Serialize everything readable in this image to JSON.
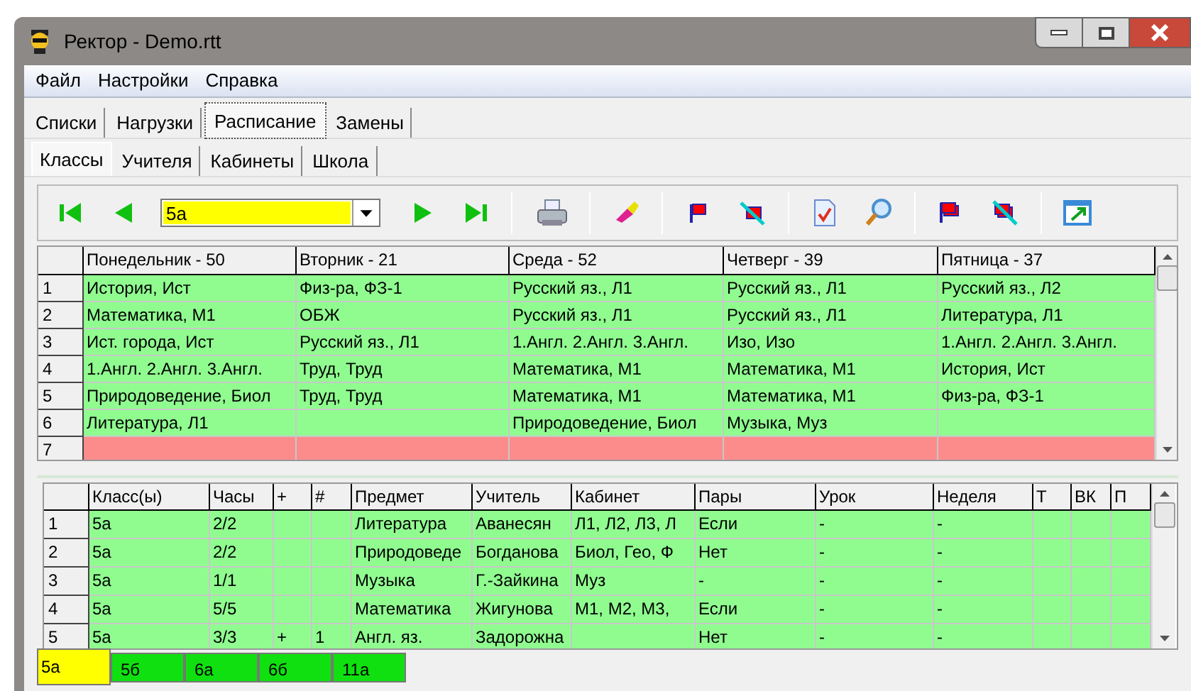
{
  "window": {
    "title": "Ректор - Demo.rtt"
  },
  "menu": [
    "Файл",
    "Настройки",
    "Справка"
  ],
  "tabs": [
    {
      "label": "Списки",
      "selected": false
    },
    {
      "label": "Нагрузки",
      "selected": false
    },
    {
      "label": "Расписание",
      "selected": true
    },
    {
      "label": "Замены",
      "selected": false
    }
  ],
  "subtabs": [
    {
      "label": "Классы",
      "selected": true
    },
    {
      "label": "Учителя",
      "selected": false
    },
    {
      "label": "Кабинеты",
      "selected": false
    },
    {
      "label": "Школа",
      "selected": false
    }
  ],
  "class_field": {
    "value": "5а"
  },
  "schedule": {
    "columns": [
      "Понедельник - 50",
      "Вторник - 21",
      "Среда - 52",
      "Четверг - 39",
      "Пятница - 37"
    ],
    "rows": [
      {
        "number": "1",
        "color": "#90fc90",
        "cells": [
          "История, Ист",
          "Физ-ра, ФЗ-1",
          "Русский яз., Л1",
          "Русский яз., Л1",
          "Русский яз., Л2"
        ]
      },
      {
        "number": "2",
        "color": "#90fc90",
        "cells": [
          "Математика, М1",
          "ОБЖ",
          "Русский яз., Л1",
          "Русский яз., Л1",
          "Литература, Л1"
        ]
      },
      {
        "number": "3",
        "color": "#90fc90",
        "cells": [
          "Ист. города, Ист",
          "Русский яз., Л1",
          "1.Англ.  2.Англ.  3.Англ.",
          "Изо, Изо",
          "1.Англ.  2.Англ.  3.Англ."
        ]
      },
      {
        "number": "4",
        "color": "#90fc90",
        "cells": [
          "1.Англ.  2.Англ.  3.Англ.",
          "Труд, Труд",
          "Математика, М1",
          "Математика, М1",
          "История, Ист"
        ]
      },
      {
        "number": "5",
        "color": "#90fc90",
        "cells": [
          "Природоведение, Биол",
          "Труд, Труд",
          "Математика, М1",
          "Математика, М1",
          "Физ-ра, ФЗ-1"
        ]
      },
      {
        "number": "6",
        "color": "#90fc90",
        "cells": [
          "Литература, Л1",
          "",
          "Природоведение, Биол",
          "Музыка, Муз",
          ""
        ]
      },
      {
        "number": "7",
        "color": "#fc8c8c",
        "cells": [
          "",
          "",
          "",
          "",
          ""
        ]
      }
    ]
  },
  "lessons": {
    "columns": [
      "Класс(ы)",
      "Часы",
      "+",
      "#",
      "Предмет",
      "Учитель",
      "Кабинет",
      "Пары",
      "Урок",
      "Неделя",
      "Т",
      "ВК",
      "П"
    ],
    "rows": [
      {
        "number": "1",
        "cells": [
          "5а",
          "2/2",
          "",
          "",
          "Литература",
          "Аванесян",
          "Л1, Л2, Л3, Л",
          "Если",
          "-",
          "-",
          "",
          "",
          ""
        ]
      },
      {
        "number": "2",
        "cells": [
          "5а",
          "2/2",
          "",
          "",
          "Природоведе",
          "Богданова",
          "Биол, Гео, Ф",
          "Нет",
          "-",
          "-",
          "",
          "",
          ""
        ]
      },
      {
        "number": "3",
        "cells": [
          "5а",
          "1/1",
          "",
          "",
          "Музыка",
          "Г.-Зайкина",
          "Муз",
          "-",
          "-",
          "-",
          "",
          "",
          ""
        ]
      },
      {
        "number": "4",
        "cells": [
          "5а",
          "5/5",
          "",
          "",
          "Математика",
          "Жигунова",
          "М1, М2, М3,",
          "Если",
          "-",
          "-",
          "",
          "",
          ""
        ]
      },
      {
        "number": "5",
        "cells": [
          "5а",
          "3/3",
          "+",
          "1",
          "Англ. яз.",
          "Задорожна",
          "",
          "Нет",
          "-",
          "-",
          "",
          "",
          ""
        ]
      }
    ]
  },
  "class_tabs": [
    {
      "label": "5а",
      "selected": true
    },
    {
      "label": "5б",
      "selected": false
    },
    {
      "label": "6а",
      "selected": false
    },
    {
      "label": "6б",
      "selected": false
    },
    {
      "label": "11а",
      "selected": false
    }
  ]
}
